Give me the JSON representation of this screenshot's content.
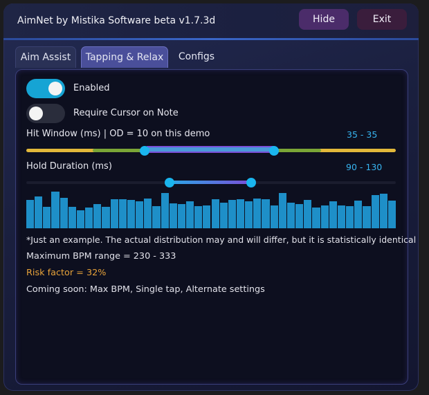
{
  "window": {
    "title": "AimNet by Mistika Software beta v1.7.3d",
    "hide_label": "Hide",
    "exit_label": "Exit"
  },
  "tabs": [
    {
      "label": "Aim Assist",
      "active": false
    },
    {
      "label": "Tapping & Relax",
      "active": true
    },
    {
      "label": "Configs",
      "active": false
    }
  ],
  "toggles": {
    "enabled": {
      "label": "Enabled",
      "on": true
    },
    "require_cursor": {
      "label": "Require Cursor on Note",
      "on": false
    }
  },
  "hit_window": {
    "label": "Hit Window (ms) | OD = 10 on this demo",
    "value_text": "35 - 35"
  },
  "hold_duration": {
    "label": "Hold Duration (ms)",
    "value_text": "90 - 130"
  },
  "distribution_bars": [
    0.75,
    0.85,
    0.58,
    0.98,
    0.82,
    0.58,
    0.48,
    0.55,
    0.65,
    0.58,
    0.78,
    0.78,
    0.76,
    0.72,
    0.8,
    0.6,
    0.95,
    0.66,
    0.64,
    0.72,
    0.6,
    0.62,
    0.78,
    0.68,
    0.76,
    0.78,
    0.72,
    0.8,
    0.78,
    0.62,
    0.95,
    0.68,
    0.64,
    0.76,
    0.56,
    0.62,
    0.72,
    0.62,
    0.6,
    0.74,
    0.6,
    0.88,
    0.92,
    0.74
  ],
  "notes": {
    "disclaimer": "*Just an example. The actual distribution may and will differ, but it is statistically identical",
    "bpm_range": "Maximum BPM range = 230 - 333",
    "risk_factor": "Risk factor = 32%",
    "coming_soon": "Coming soon: Max BPM, Single tap, Alternate settings"
  },
  "colors": {
    "accent": "#16a4d4",
    "risk": "#e8a33a",
    "range_text": "#37b4f0",
    "bar": "#1e8fc8",
    "hit_window_gold": "#e2b83a",
    "hit_window_green": "#7aa536",
    "hit_window_blue": "#4a9ad8"
  }
}
